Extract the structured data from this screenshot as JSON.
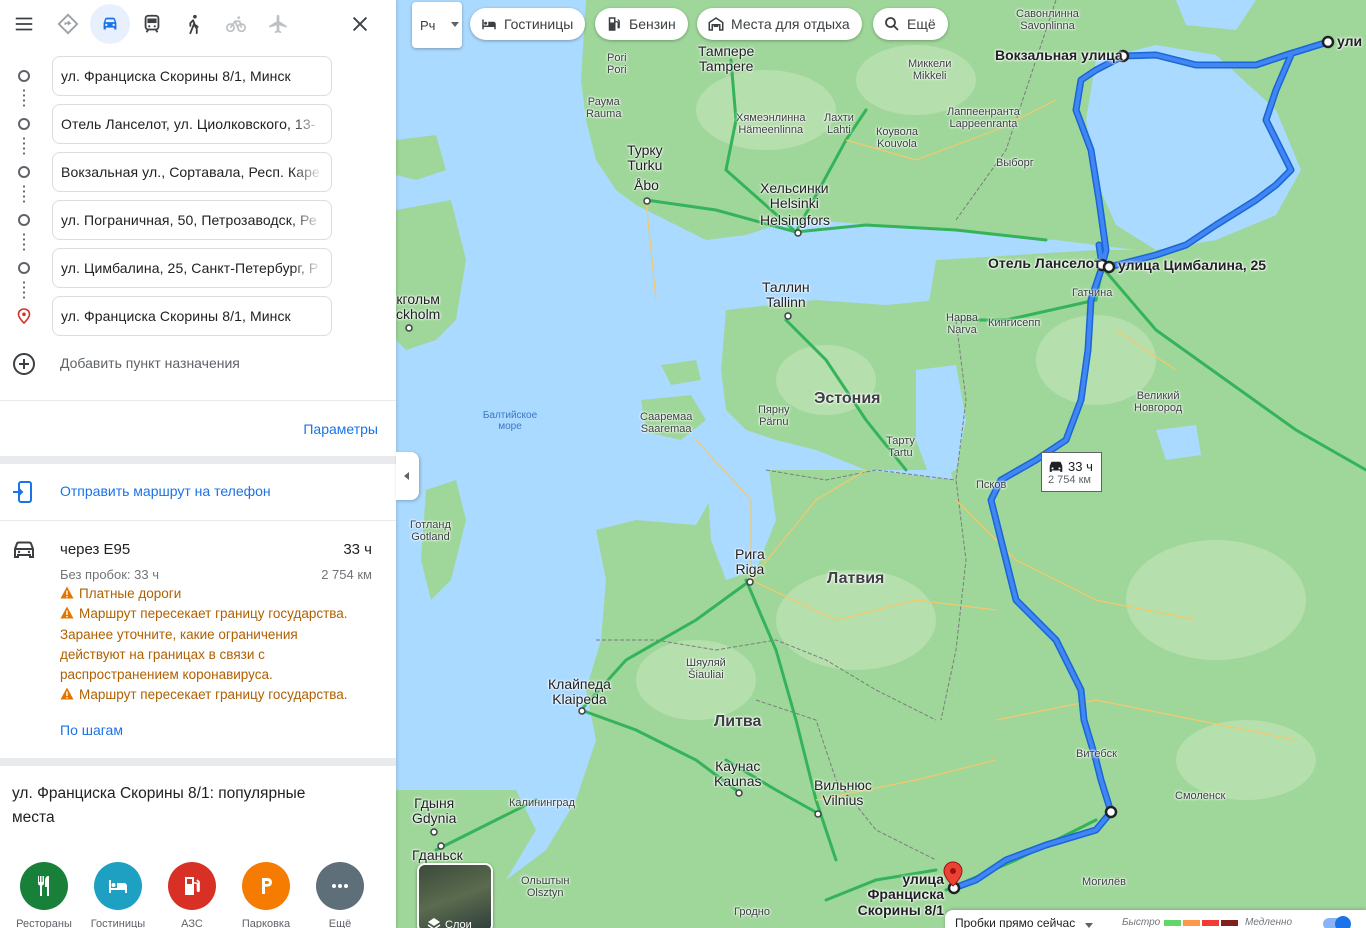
{
  "travel_modes": [
    {
      "name": "best-route",
      "active": false
    },
    {
      "name": "driving",
      "active": true
    },
    {
      "name": "transit",
      "active": false
    },
    {
      "name": "walking",
      "active": false
    },
    {
      "name": "cycling",
      "active": false
    },
    {
      "name": "flights",
      "active": false
    }
  ],
  "waypoints": [
    "ул. Франциска Скорины 8/1, Минск",
    "Отель Ланселот, ул. Циолковского, 13-",
    "Вокзальная ул., Сортавала, Респ. Каре",
    "ул. Пограничная, 50, Петрозаводск, Ре",
    "ул. Цимбалина, 25, Санкт-Петербург, Р",
    "ул. Франциска Скорины 8/1, Минск"
  ],
  "add_destination": "Добавить пункт назначения",
  "parameters": "Параметры",
  "send_to_phone": "Отправить маршрут на телефон",
  "route": {
    "via": "через E95",
    "time": "33 ч",
    "no_traffic": "Без пробок: 33 ч",
    "distance": "2 754 км",
    "warnings": [
      "Платные дороги",
      "Маршрут пересекает границу государства.",
      "Заранее уточните, какие ограничения",
      "действуют на границах в связи с",
      "распространением коронавируса.",
      "Маршрут пересекает границу государства."
    ],
    "steps": "По шагам"
  },
  "popular": {
    "title": "ул. Франциска Скорины 8/1: популярные места",
    "categories": [
      {
        "icon": "restaurant-icon",
        "label": "Рестораны",
        "color": "#188038"
      },
      {
        "icon": "hotel-icon",
        "label": "Гостиницы",
        "color": "#1ea0c3"
      },
      {
        "icon": "gas-station-icon",
        "label": "АЗС",
        "color": "#d93025"
      },
      {
        "icon": "parking-icon",
        "label": "Парковка",
        "color": "#f57c00"
      },
      {
        "icon": "more-icon",
        "label": "Ещё",
        "color": "#5f6f7a"
      }
    ]
  },
  "map": {
    "layer_select": "Рч",
    "chips": [
      "Гостиницы",
      "Бензин",
      "Места для отдыха",
      "Ещё"
    ],
    "route_box": {
      "time": "33 ч",
      "distance": "2 754 км"
    },
    "layers_label": "Слои",
    "traffic": {
      "now": "Пробки прямо сейчас",
      "fast": "Быстро",
      "slow": "Медленно",
      "colors": [
        "#63d668",
        "#ff974d",
        "#f23c32",
        "#811f1f"
      ]
    },
    "labels": {
      "countries": [
        "Эстония",
        "Латвия",
        "Литва"
      ],
      "sea": "Балтийское море",
      "waypoint_labels": [
        "Вокзальная улица",
        "Отель Ланселот",
        "улица Цимбалина, 25",
        "улица Франциска Скорины 8/1",
        "ули"
      ],
      "cities": [
        [
          "Тампере",
          "Tampere"
        ],
        [
          "Турку",
          "Turku"
        ],
        [
          "Åbo",
          ""
        ],
        [
          "Хельсинки",
          "Helsinki"
        ],
        [
          "Helsingfors",
          ""
        ],
        [
          "Таллин",
          "Tallinn"
        ],
        [
          "Рига",
          "Riga"
        ],
        [
          "Клайпеда",
          "Klaipeda"
        ],
        [
          "Каунас",
          "Kaunas"
        ],
        [
          "Вильнюс",
          "Vilnius"
        ],
        [
          "Гдыня",
          "Gdynia"
        ],
        [
          "Гданьск",
          ""
        ],
        [
          "кгольм",
          "ckholm"
        ]
      ],
      "towns": [
        [
          "Pori",
          "Pori"
        ],
        [
          "Раума",
          "Rauma"
        ],
        [
          "Хямеэнлинна",
          "Hämeenlinna"
        ],
        [
          "Лахти",
          "Lahti"
        ],
        [
          "Коувола",
          "Kouvola"
        ],
        [
          "Миккели",
          "Mikkeli"
        ],
        [
          "Савонлинна",
          "Savonlinna"
        ],
        [
          "Лаппеенранта",
          "Lappeenranta"
        ],
        [
          "Выборг",
          ""
        ],
        [
          "Гатчина",
          ""
        ],
        [
          "Нарва",
          "Narva"
        ],
        [
          "Кингисепп",
          ""
        ],
        [
          "Великий",
          "Новгород"
        ],
        [
          "Псков",
          ""
        ],
        [
          "Пярну",
          "Pärnu"
        ],
        [
          "Тарту",
          "Tartu"
        ],
        [
          "Сааремаа",
          "Saaremaa"
        ],
        [
          "Готланд",
          "Gotland"
        ],
        [
          "Шяуляй",
          "Šiauliai"
        ],
        [
          "Витебск",
          ""
        ],
        [
          "Смоленск",
          ""
        ],
        [
          "Могилёв",
          ""
        ],
        [
          "Калининград",
          ""
        ],
        [
          "Ольштын",
          "Olsztyn"
        ],
        [
          "Гродно",
          ""
        ]
      ]
    }
  }
}
